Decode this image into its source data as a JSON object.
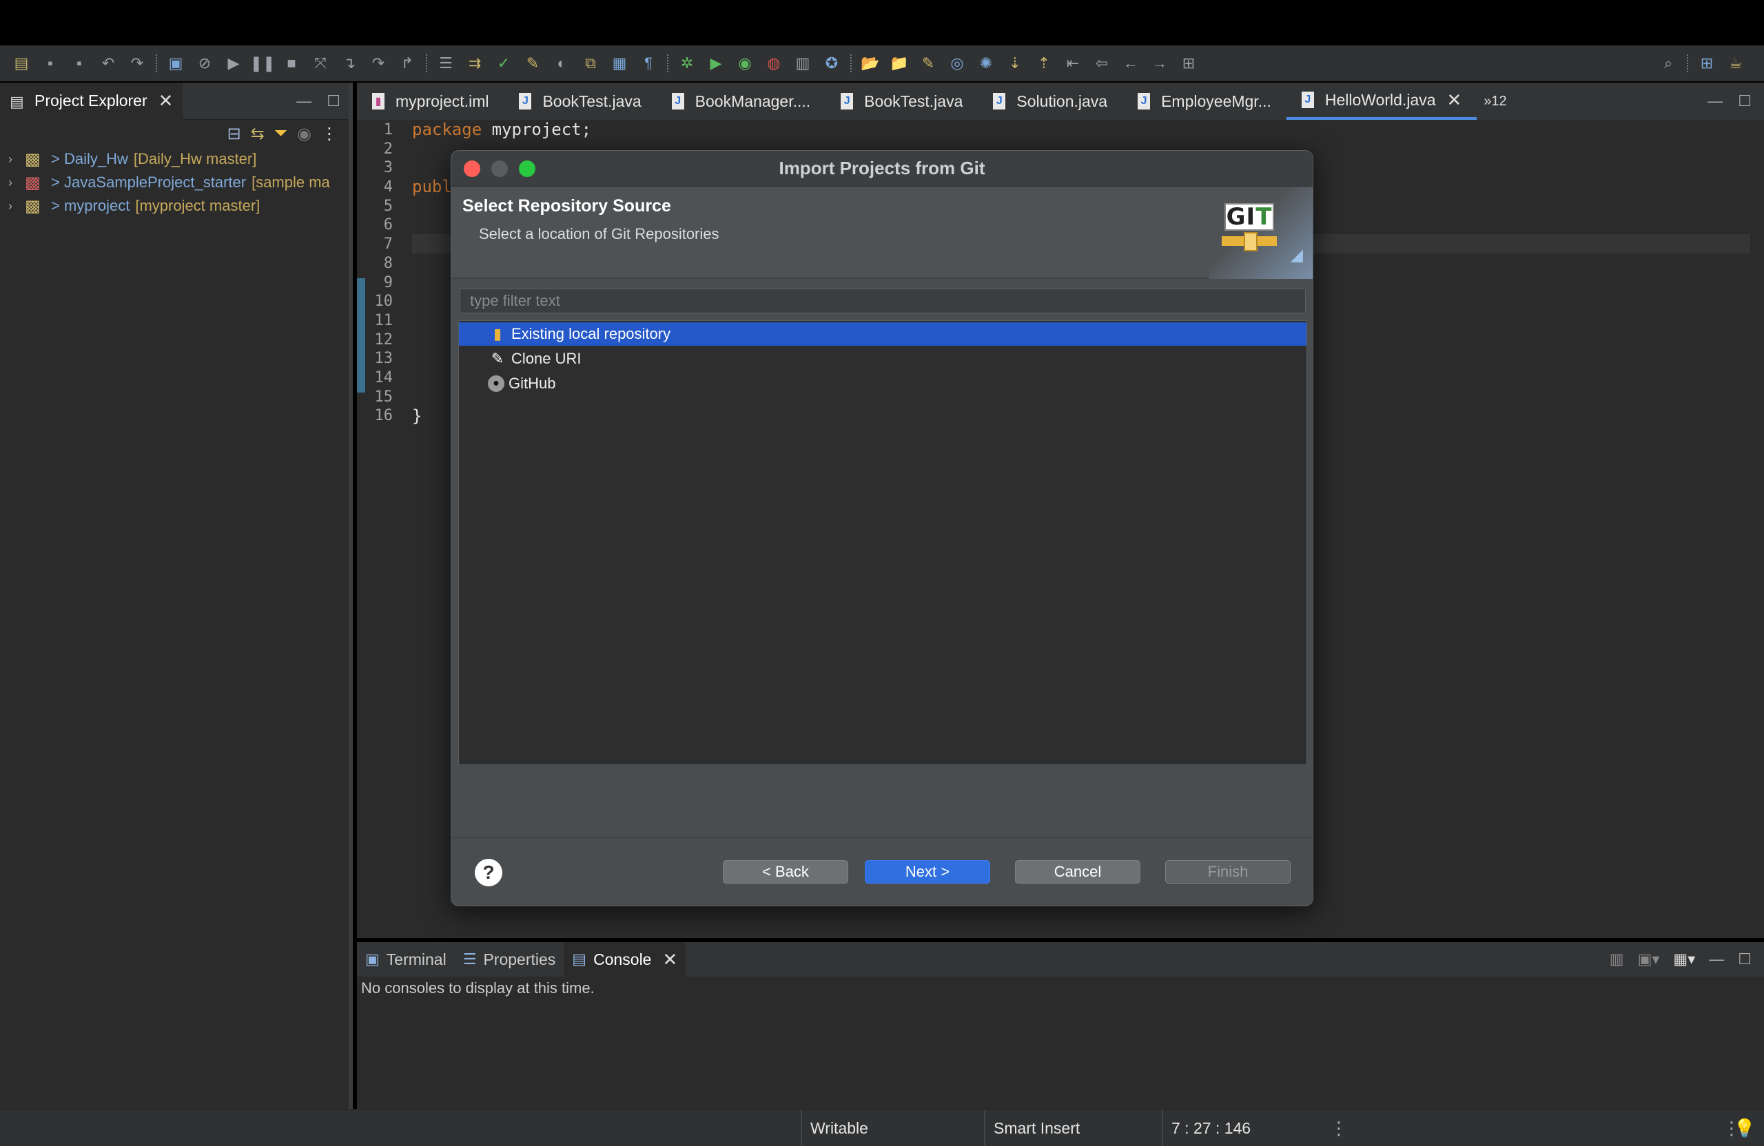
{
  "toolbar": {
    "icons": [
      "new-icon",
      "save-icon",
      "save-all-icon",
      "undo-icon",
      "redo-icon",
      "terminal-icon",
      "debug-skip-icon",
      "resume-icon",
      "suspend-icon",
      "terminate-icon",
      "disconnect-icon",
      "step-into-icon",
      "step-over-icon",
      "step-return-icon",
      "drop-to-frame-icon",
      "use-step-filters-icon",
      "toggle-breakpoint-icon",
      "mark-occurrences-icon",
      "toggle-block-icon",
      "open-type-icon",
      "show-whitespace-icon",
      "debug-icon",
      "run-icon",
      "coverage-icon",
      "external-tools-icon",
      "new-java-project-icon",
      "new-package-icon",
      "new-class-icon",
      "open-folder-icon",
      "search-icon",
      "next-annotation-icon",
      "prev-annotation-icon",
      "last-edit-icon",
      "back-icon",
      "forward-icon",
      "pin-icon"
    ],
    "right_icons": [
      "search-icon",
      "perspective-icon",
      "java-perspective-icon"
    ]
  },
  "explorer": {
    "title": "Project Explorer",
    "projects": [
      {
        "name": "> Daily_Hw",
        "branch": "[Daily_Hw master]"
      },
      {
        "name": "> JavaSampleProject_starter",
        "branch": "[sample ma"
      },
      {
        "name": "> myproject",
        "branch": "[myproject master]"
      }
    ]
  },
  "editor": {
    "tabs": [
      {
        "label": "myproject.iml",
        "icon": "xml-file-icon",
        "active": false
      },
      {
        "label": "BookTest.java",
        "icon": "java-file-icon",
        "active": false
      },
      {
        "label": "BookManager....",
        "icon": "java-file-icon",
        "active": false
      },
      {
        "label": "BookTest.java",
        "icon": "java-file-icon",
        "active": false
      },
      {
        "label": "Solution.java",
        "icon": "java-file-icon",
        "active": false
      },
      {
        "label": "EmployeeMgr...",
        "icon": "java-file-icon",
        "active": false
      },
      {
        "label": "HelloWorld.java",
        "icon": "java-file-icon",
        "active": true
      }
    ],
    "overflow": "»12",
    "line_numbers": [
      "1",
      "2",
      "3",
      "4",
      "5",
      "6",
      "7",
      "8",
      "9",
      "10",
      "11",
      "12",
      "13",
      "14",
      "15",
      "16"
    ],
    "code": {
      "line1_kw": "package",
      "line1_rest": " myproject;",
      "line4": "publ",
      "line16": "}"
    }
  },
  "dialog": {
    "title": "Import Projects from Git",
    "header_title": "Select Repository Source",
    "header_subtitle": "Select a location of Git Repositories",
    "logo_text_g": "G",
    "logo_text_i": "I",
    "logo_text_t": "T",
    "filter_placeholder": "type filter text",
    "items": [
      {
        "label": "Existing local repository",
        "icon": "repository-icon",
        "selected": true
      },
      {
        "label": "Clone URI",
        "icon": "clone-icon",
        "selected": false
      },
      {
        "label": "GitHub",
        "icon": "github-icon",
        "selected": false
      }
    ],
    "help_label": "?",
    "buttons": {
      "back": "< Back",
      "next": "Next >",
      "cancel": "Cancel",
      "finish": "Finish"
    }
  },
  "bottom_panel": {
    "tabs": [
      {
        "label": "Terminal",
        "active": false
      },
      {
        "label": "Properties",
        "active": false
      },
      {
        "label": "Console",
        "active": true
      }
    ],
    "message": "No consoles to display at this time."
  },
  "statusbar": {
    "writable": "Writable",
    "insert_mode": "Smart Insert",
    "position": "7 : 27 : 146"
  }
}
